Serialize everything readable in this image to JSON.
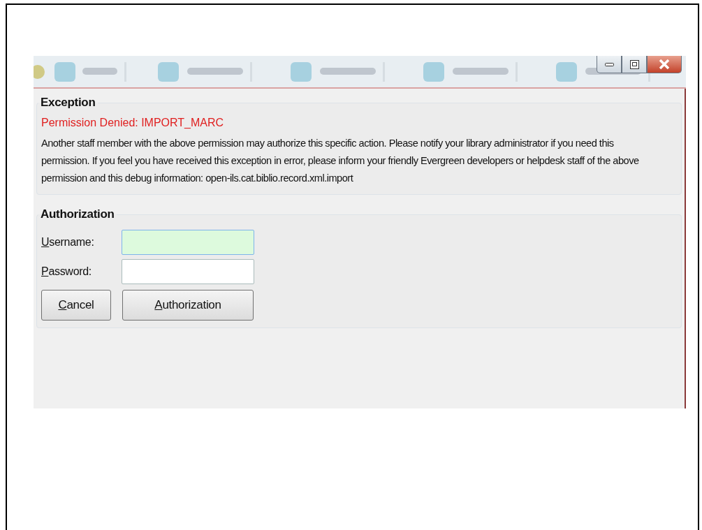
{
  "window": {
    "controls": [
      {
        "kind": "minimize"
      },
      {
        "kind": "maximize"
      },
      {
        "kind": "close"
      }
    ]
  },
  "exception": {
    "title": "Exception",
    "error": "Permission Denied: IMPORT_MARC",
    "message": "Another staff member with the above permission may authorize this specific action. Please notify your library administrator if you need this permission. If you feel you have received this exception in error, please inform your friendly Evergreen developers or helpdesk staff of the above permission and this debug information: open-ils.cat.biblio.record.xml.import"
  },
  "authorization": {
    "title": "Authorization",
    "fields": [
      {
        "label": "Username:",
        "focused": true
      },
      {
        "label": "Password:",
        "focused": false
      }
    ],
    "buttons": [
      {
        "label": "Cancel",
        "kind": "cancel"
      },
      {
        "label": "Authorization",
        "kind": "submit"
      }
    ]
  }
}
